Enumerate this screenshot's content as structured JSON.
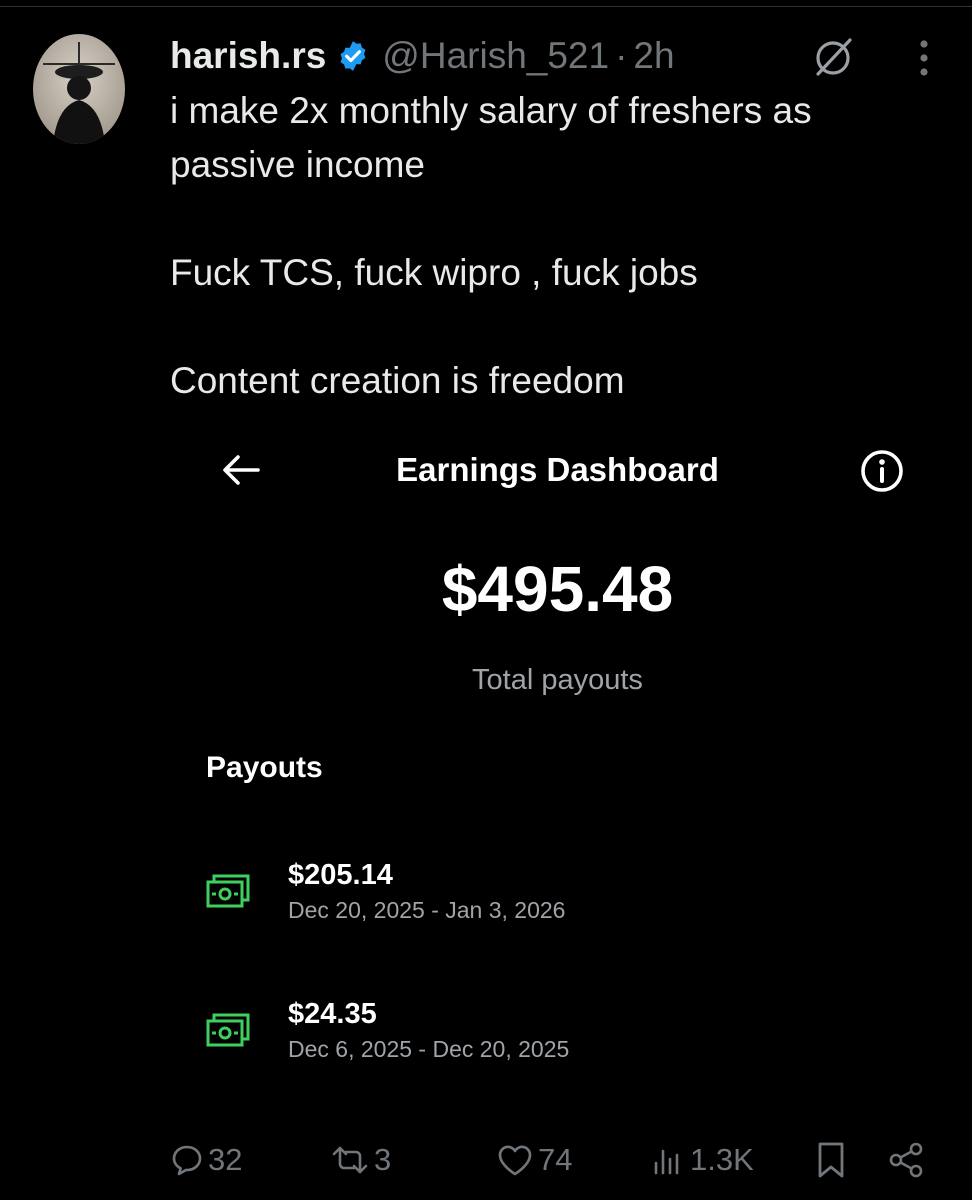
{
  "tweet": {
    "author_name": "harish.rs",
    "handle": "@Harish_521",
    "separator": "·",
    "time": "2h",
    "text_lines": [
      "i make 2x monthly salary of freshers as passive income",
      "Fuck TCS, fuck wipro , fuck jobs",
      "Content creation is freedom"
    ],
    "icons": {
      "verified": "verified-badge-icon",
      "grok": "grok-icon",
      "more": "more-vertical-icon"
    }
  },
  "media": {
    "title": "Earnings Dashboard",
    "total_amount": "$495.48",
    "total_label": "Total payouts",
    "payouts_heading": "Payouts",
    "payouts": [
      {
        "amount": "$205.14",
        "range": "Dec 20, 2025 - Jan 3, 2026",
        "icon": "cash-icon"
      },
      {
        "amount": "$24.35",
        "range": "Dec 6, 2025 - Dec 20, 2025",
        "icon": "cash-icon"
      }
    ]
  },
  "actions": {
    "replies": "32",
    "reposts": "3",
    "likes": "74",
    "views": "1.3K"
  },
  "colors": {
    "background": "#000000",
    "text": "#e7e9ea",
    "muted": "#71767b",
    "verified": "#1d9bf0",
    "cash": "#3ecf5e"
  }
}
